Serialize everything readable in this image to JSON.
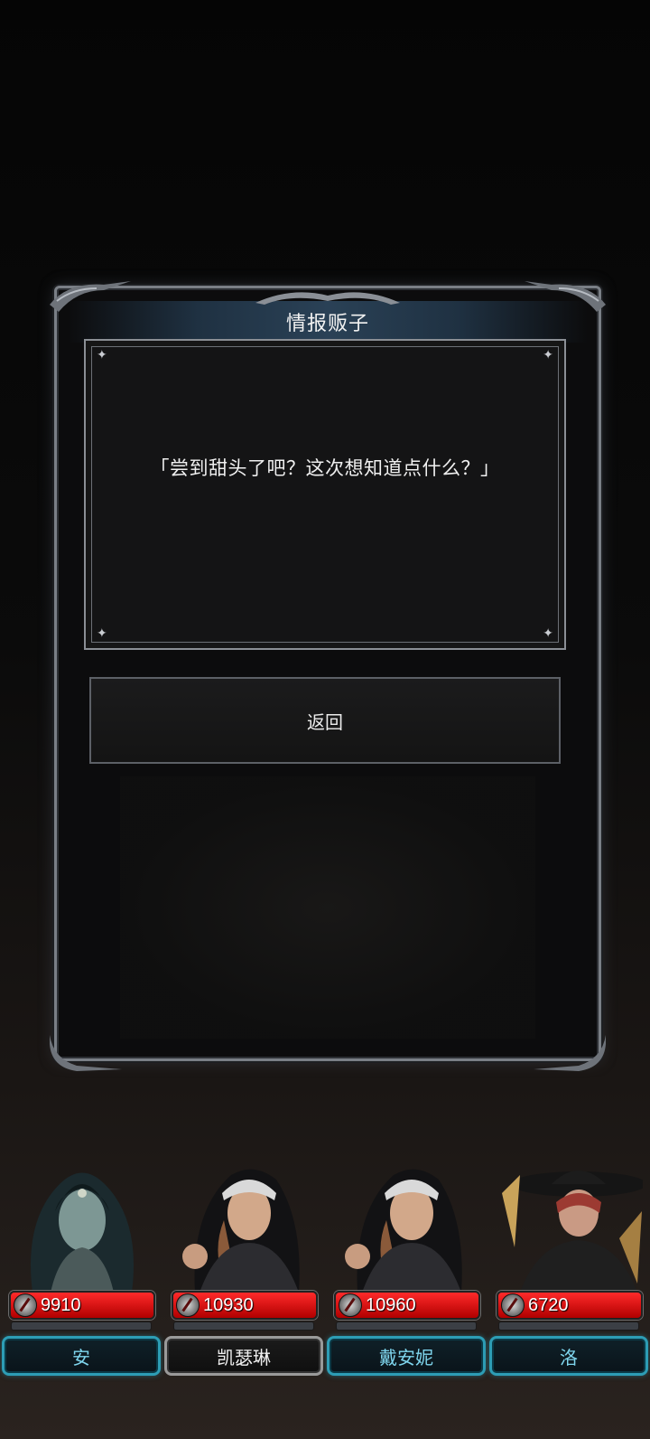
{
  "dialog": {
    "title": "情报贩子",
    "message": "「尝到甜头了吧？这次想知道点什么？」",
    "back_label": "返回"
  },
  "party": [
    {
      "name": "安",
      "hp": "9910",
      "highlighted": true
    },
    {
      "name": "凯瑟琳",
      "hp": "10930",
      "highlighted": false
    },
    {
      "name": "戴安妮",
      "hp": "10960",
      "highlighted": true
    },
    {
      "name": "洛",
      "hp": "6720",
      "highlighted": true
    }
  ],
  "colors": {
    "hp_bar": "#e01010",
    "name_plate_accent": "#2d9db5",
    "panel_border": "#7a7f86"
  }
}
